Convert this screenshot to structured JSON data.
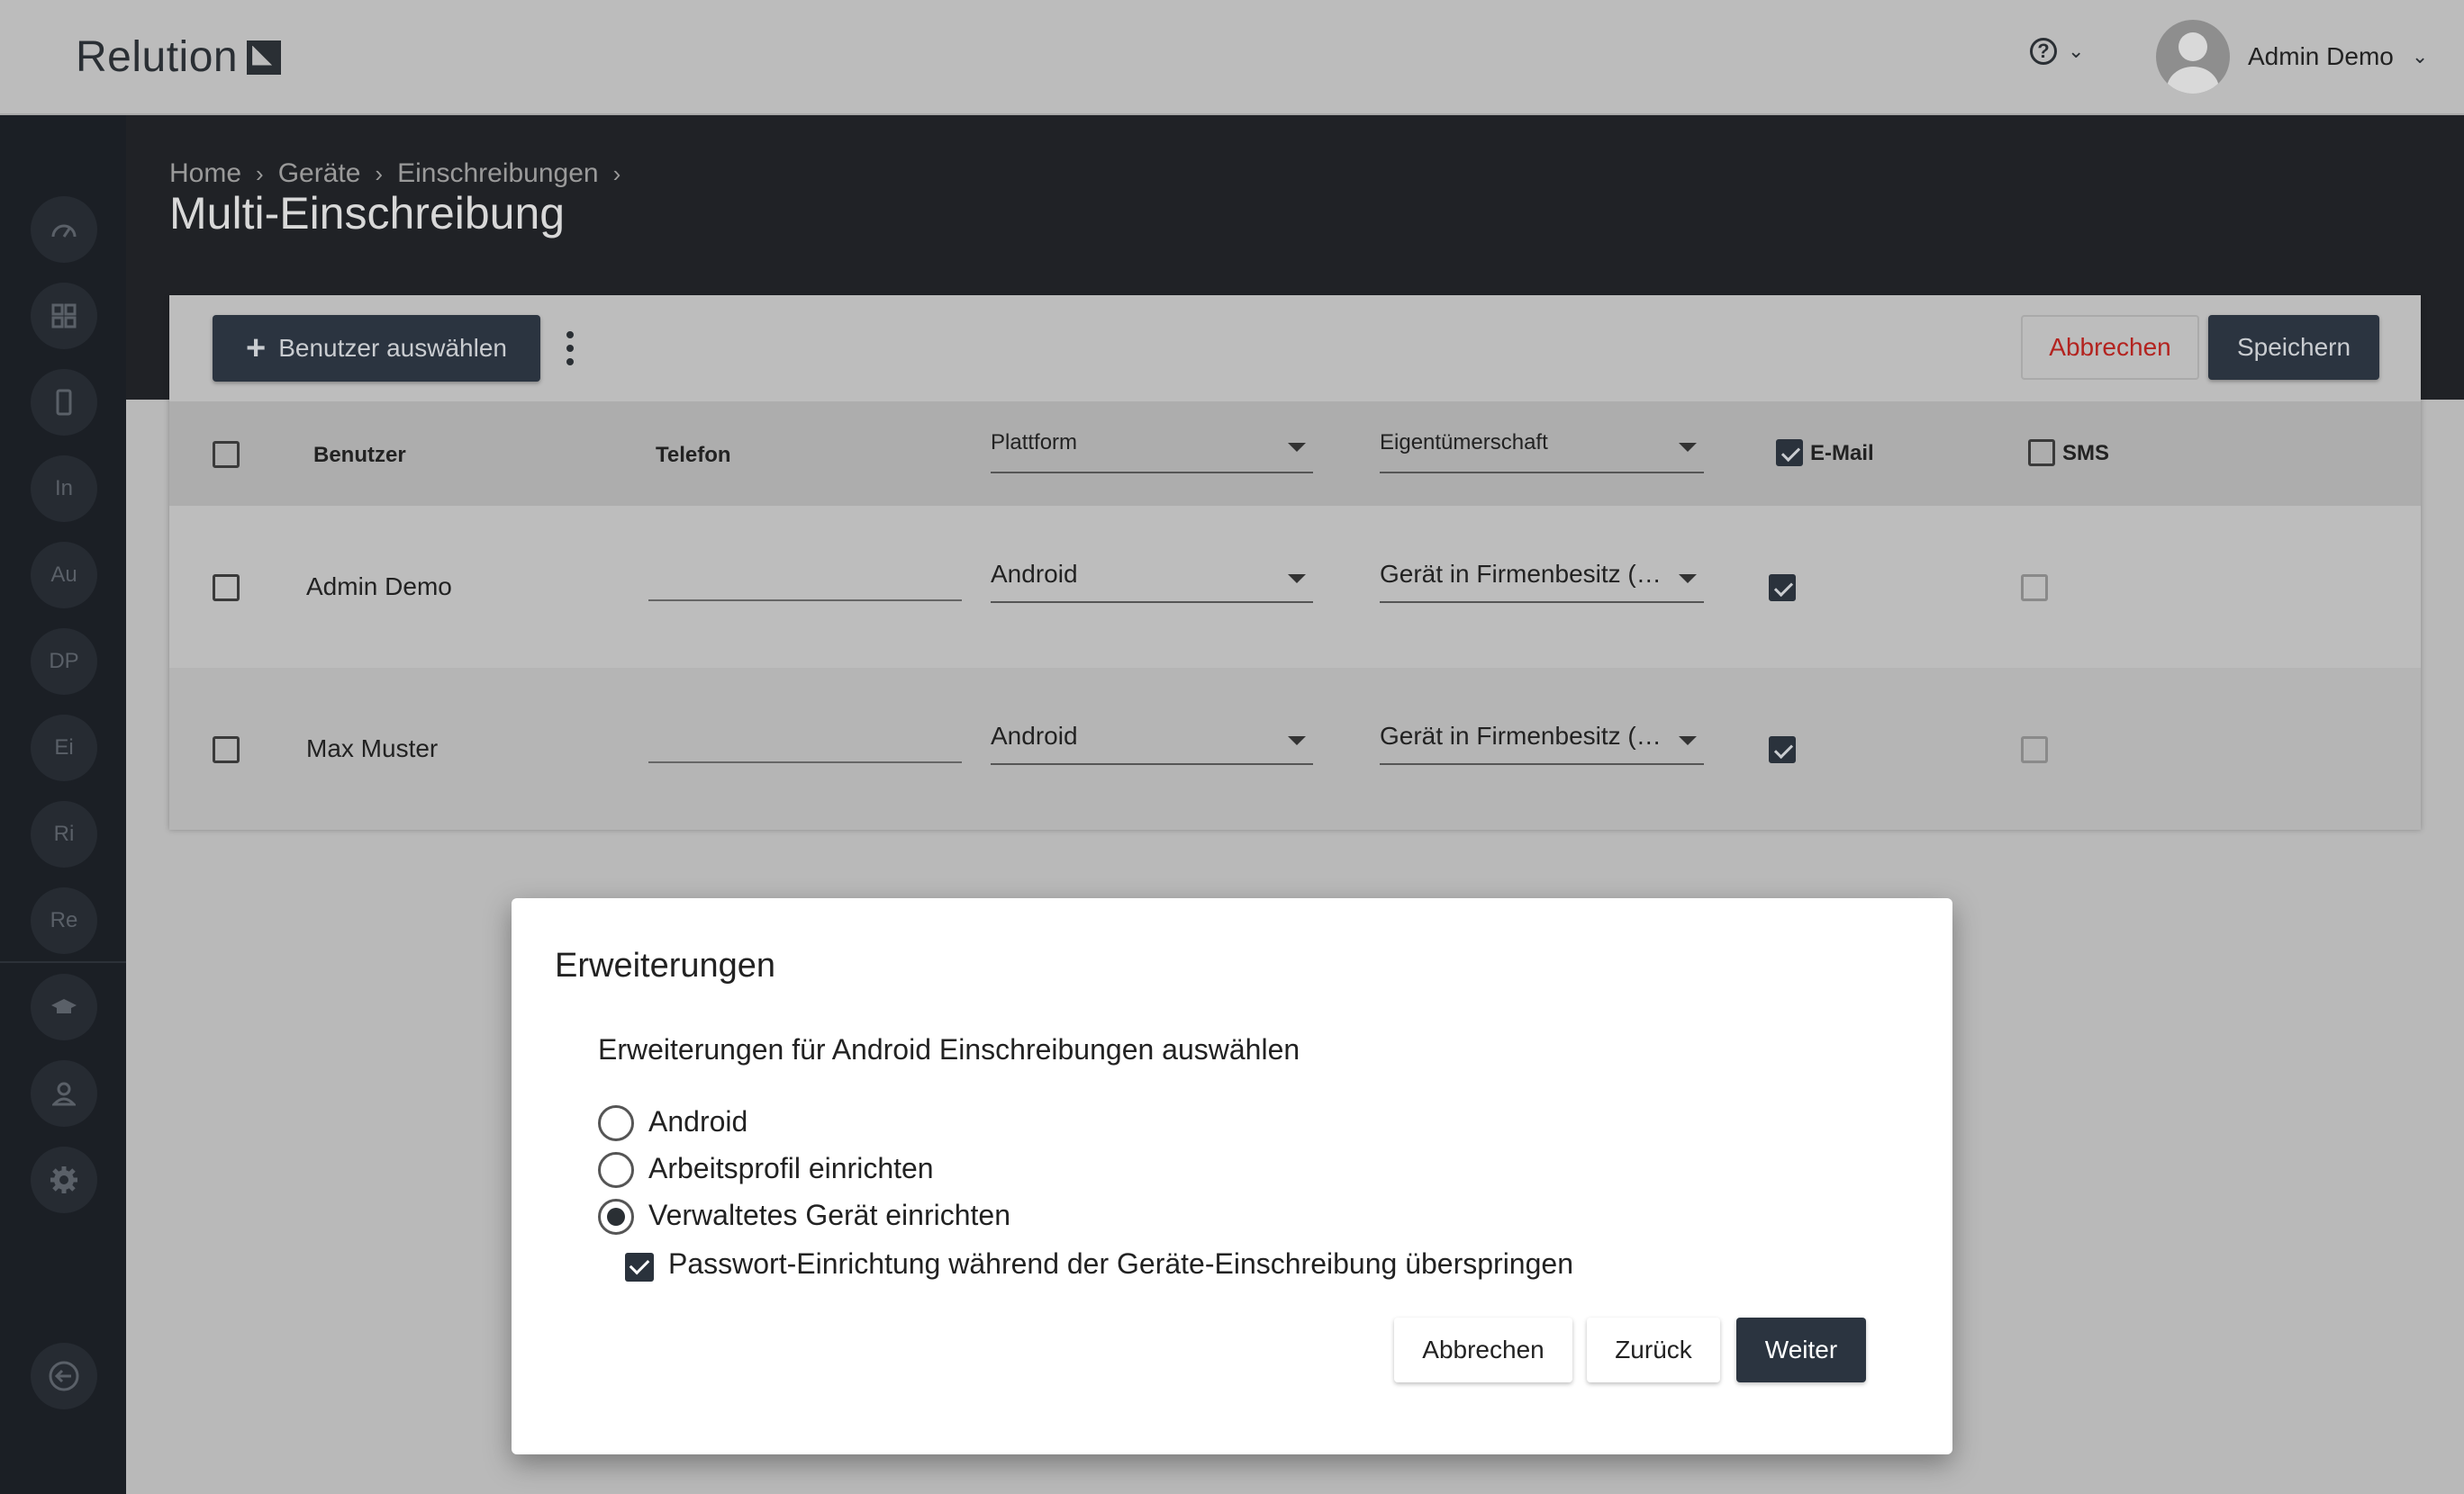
{
  "app": {
    "logo_text": "Relution",
    "user_name": "Admin Demo",
    "help_glyph": "?"
  },
  "sidebar": {
    "items": [
      {
        "name": "dashboard-icon",
        "label": ""
      },
      {
        "name": "apps-grid-icon",
        "label": ""
      },
      {
        "name": "device-icon",
        "label": ""
      },
      {
        "name": "sidebar-item-in",
        "label": "In"
      },
      {
        "name": "sidebar-item-au",
        "label": "Au"
      },
      {
        "name": "sidebar-item-dp",
        "label": "DP"
      },
      {
        "name": "sidebar-item-ei",
        "label": "Ei"
      },
      {
        "name": "sidebar-item-ri",
        "label": "Ri"
      },
      {
        "name": "sidebar-item-re",
        "label": "Re"
      },
      {
        "name": "education-icon",
        "label": ""
      },
      {
        "name": "user-icon",
        "label": ""
      },
      {
        "name": "gear-icon",
        "label": ""
      },
      {
        "name": "logout-icon",
        "label": ""
      }
    ]
  },
  "breadcrumb": [
    "Home",
    "Geräte",
    "Einschreibungen"
  ],
  "page_title": "Multi-Einschreibung",
  "toolbar": {
    "add_user_label": "Benutzer auswählen",
    "cancel_label": "Abbrechen",
    "save_label": "Speichern"
  },
  "table": {
    "headers": {
      "user": "Benutzer",
      "phone": "Telefon",
      "platform": "Plattform",
      "ownership": "Eigentümerschaft",
      "email": "E-Mail",
      "sms": "SMS"
    },
    "header_email_checked": true,
    "header_sms_checked": false,
    "rows": [
      {
        "user": "Admin Demo",
        "phone": "",
        "platform": "Android",
        "ownership": "Gerät in Firmenbesitz (C...",
        "email": true,
        "sms": false
      },
      {
        "user": "Max Muster",
        "phone": "",
        "platform": "Android",
        "ownership": "Gerät in Firmenbesitz (C...",
        "email": true,
        "sms": false
      }
    ]
  },
  "dialog": {
    "title": "Erweiterungen",
    "subtitle": "Erweiterungen für Android Einschreibungen auswählen",
    "options": [
      {
        "label": "Android",
        "selected": false
      },
      {
        "label": "Arbeitsprofil einrichten",
        "selected": false
      },
      {
        "label": "Verwaltetes Gerät einrichten",
        "selected": true
      }
    ],
    "checkbox_label": "Passwort-Einrichtung während der Geräte-Einschreibung überspringen",
    "checkbox_checked": true,
    "buttons": {
      "cancel": "Abbrechen",
      "back": "Zurück",
      "next": "Weiter"
    }
  }
}
